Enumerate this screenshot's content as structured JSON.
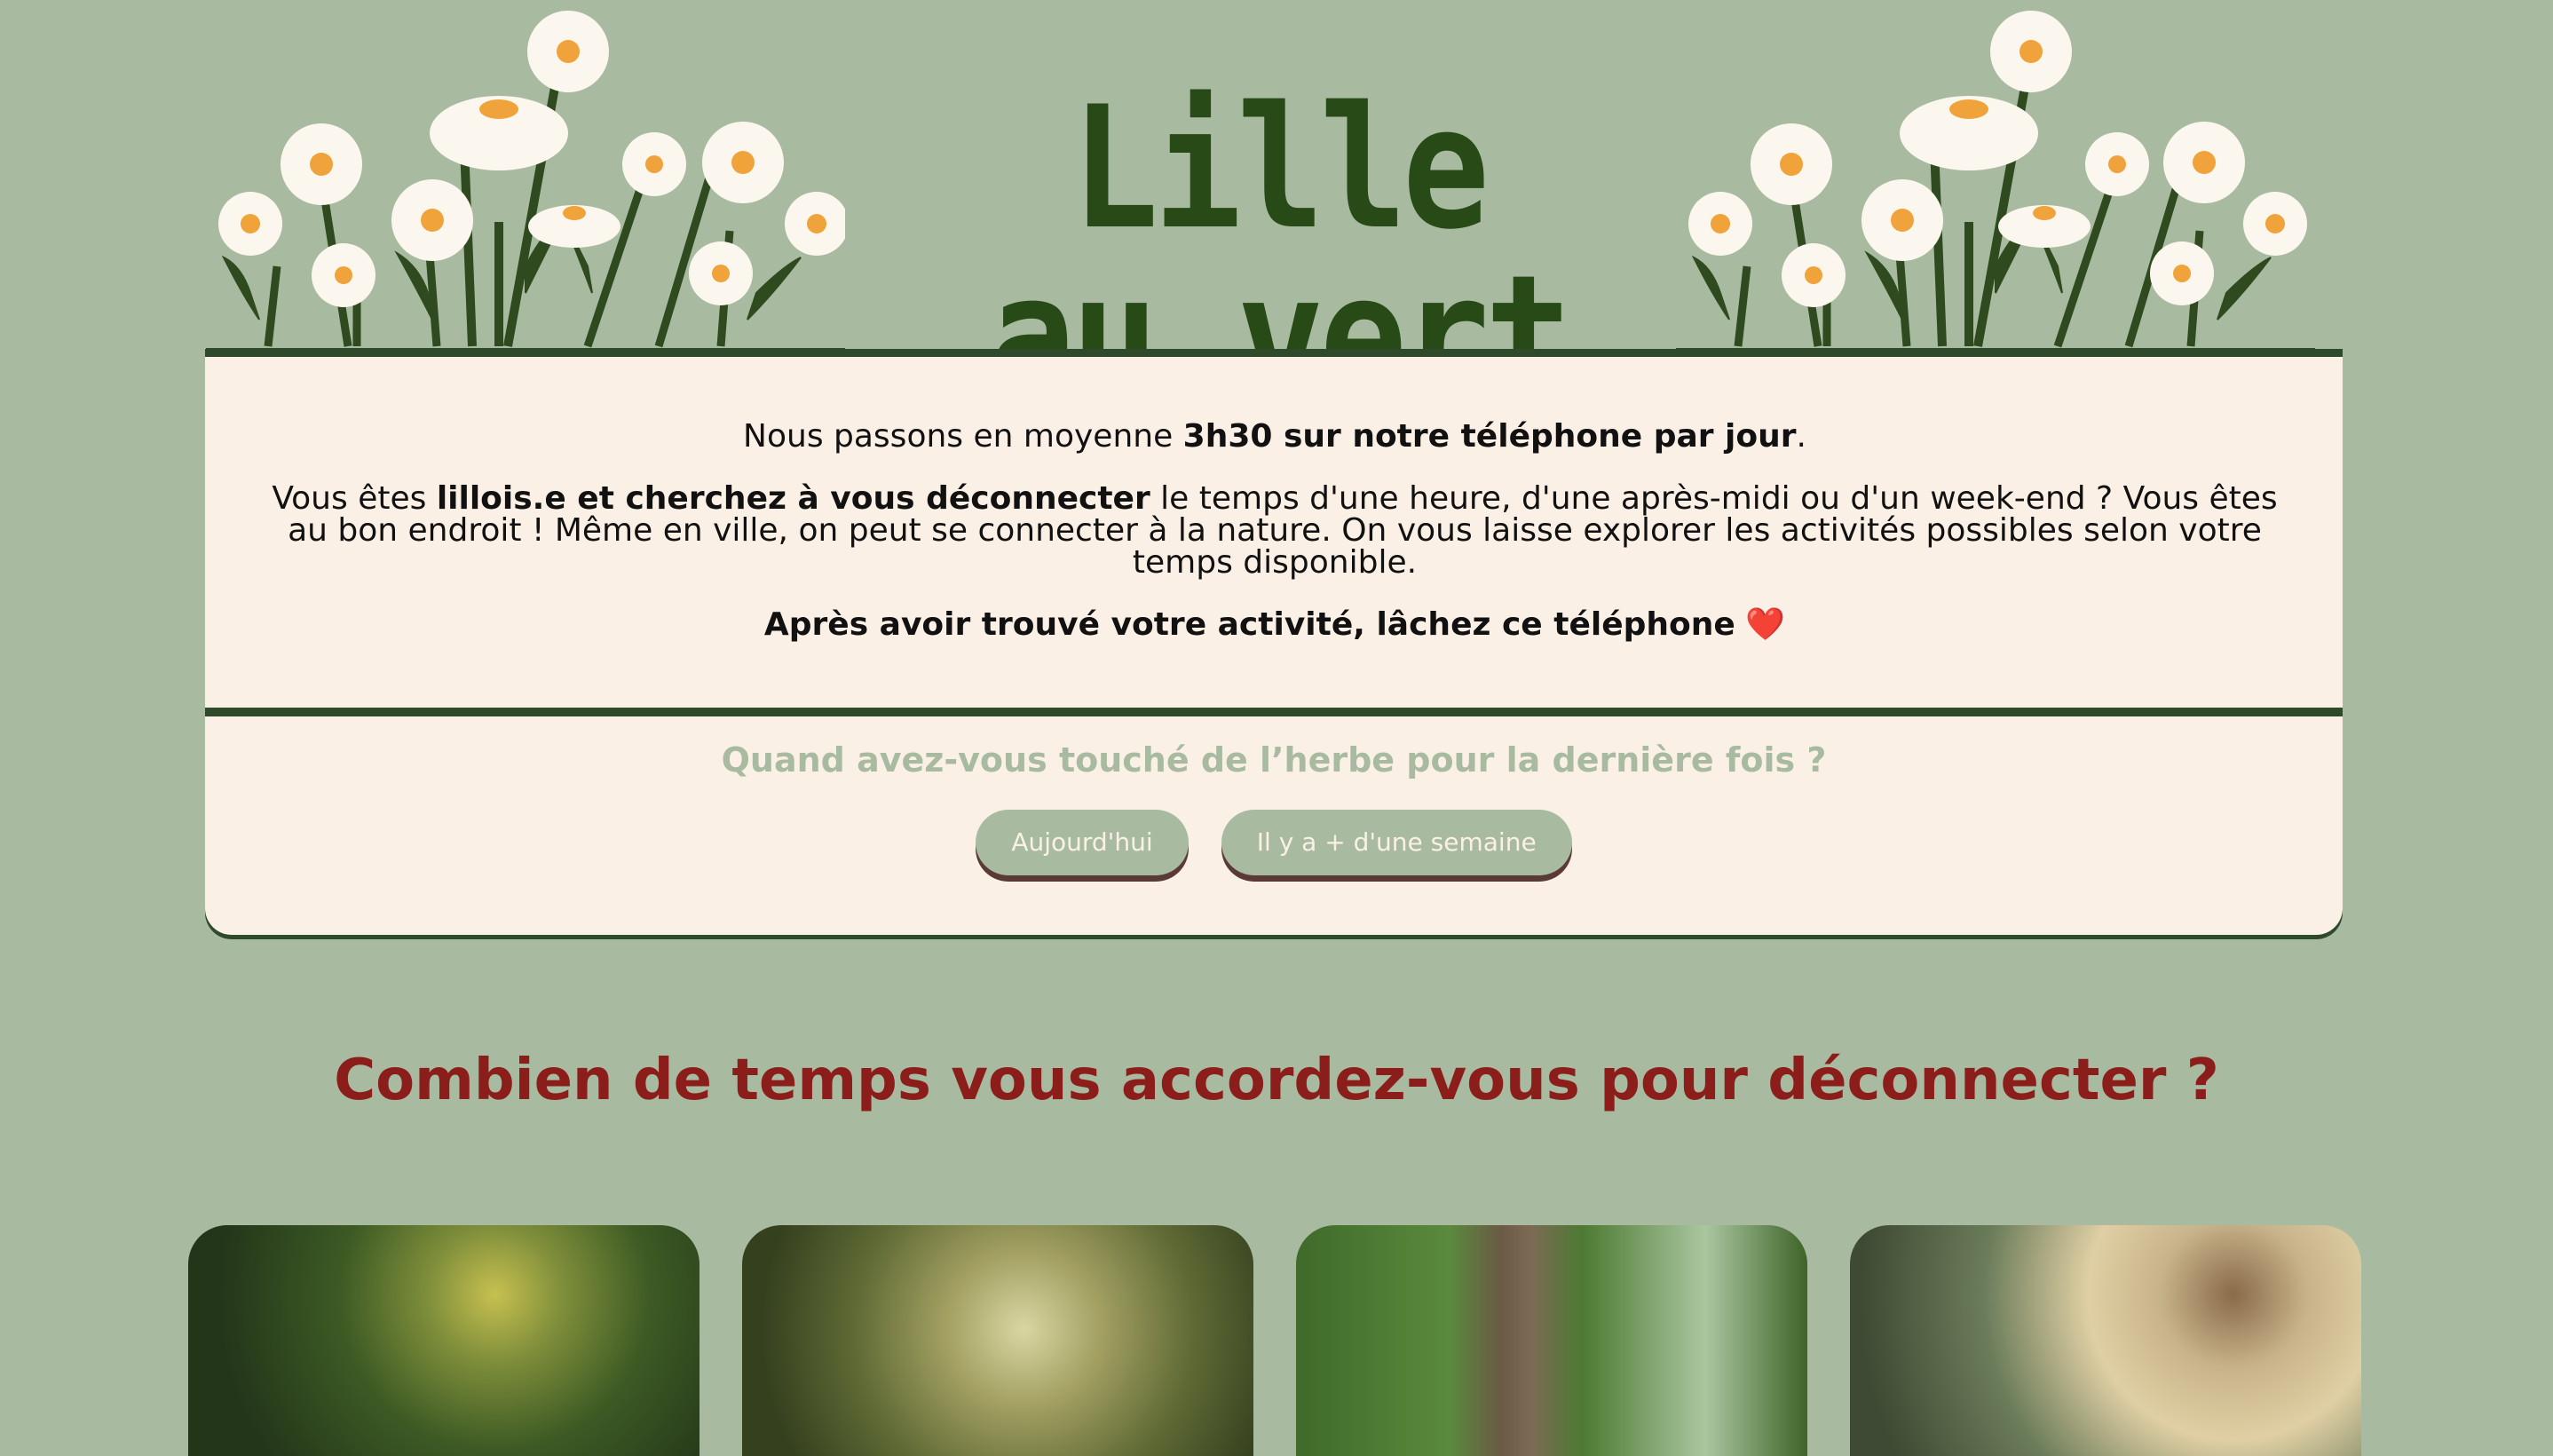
{
  "header": {
    "title": "Lille au vert"
  },
  "intro": {
    "p1_before": "Nous passons en moyenne ",
    "p1_bold": "3h30 sur notre téléphone par jour",
    "p1_after": ".",
    "p2_before": "Vous êtes ",
    "p2_bold": "lillois.e et cherchez à vous déconnecter",
    "p2_after": " le temps d'une heure, d'une après-midi ou d'un week-end ? Vous êtes au bon endroit ! Même en ville, on peut se connecter à la nature. On vous laisse explorer les activités possibles selon votre temps disponible.",
    "p3": "Après avoir trouvé votre activité, lâchez ce téléphone",
    "p3_emoji": "❤️"
  },
  "quiz": {
    "question": "Quand avez-vous touché de l’herbe pour la dernière fois ?",
    "buttons": [
      "Aujourd'hui",
      "Il y a + d'une semaine"
    ]
  },
  "section": {
    "heading": "Combien de temps vous accordez-vous pour déconnecter ?"
  },
  "colors": {
    "background": "#a8bba0",
    "card": "#fbf0e6",
    "dark_green": "#274a17",
    "heading_red": "#8b1e1a",
    "button_shadow": "#5a3a36"
  },
  "cards": [
    {
      "image": "trees-yellow-foliage-photo"
    },
    {
      "image": "forest-path-photo"
    },
    {
      "image": "tree-trunk-canopy-photo"
    },
    {
      "image": "woman-wildflowers-photo"
    }
  ]
}
